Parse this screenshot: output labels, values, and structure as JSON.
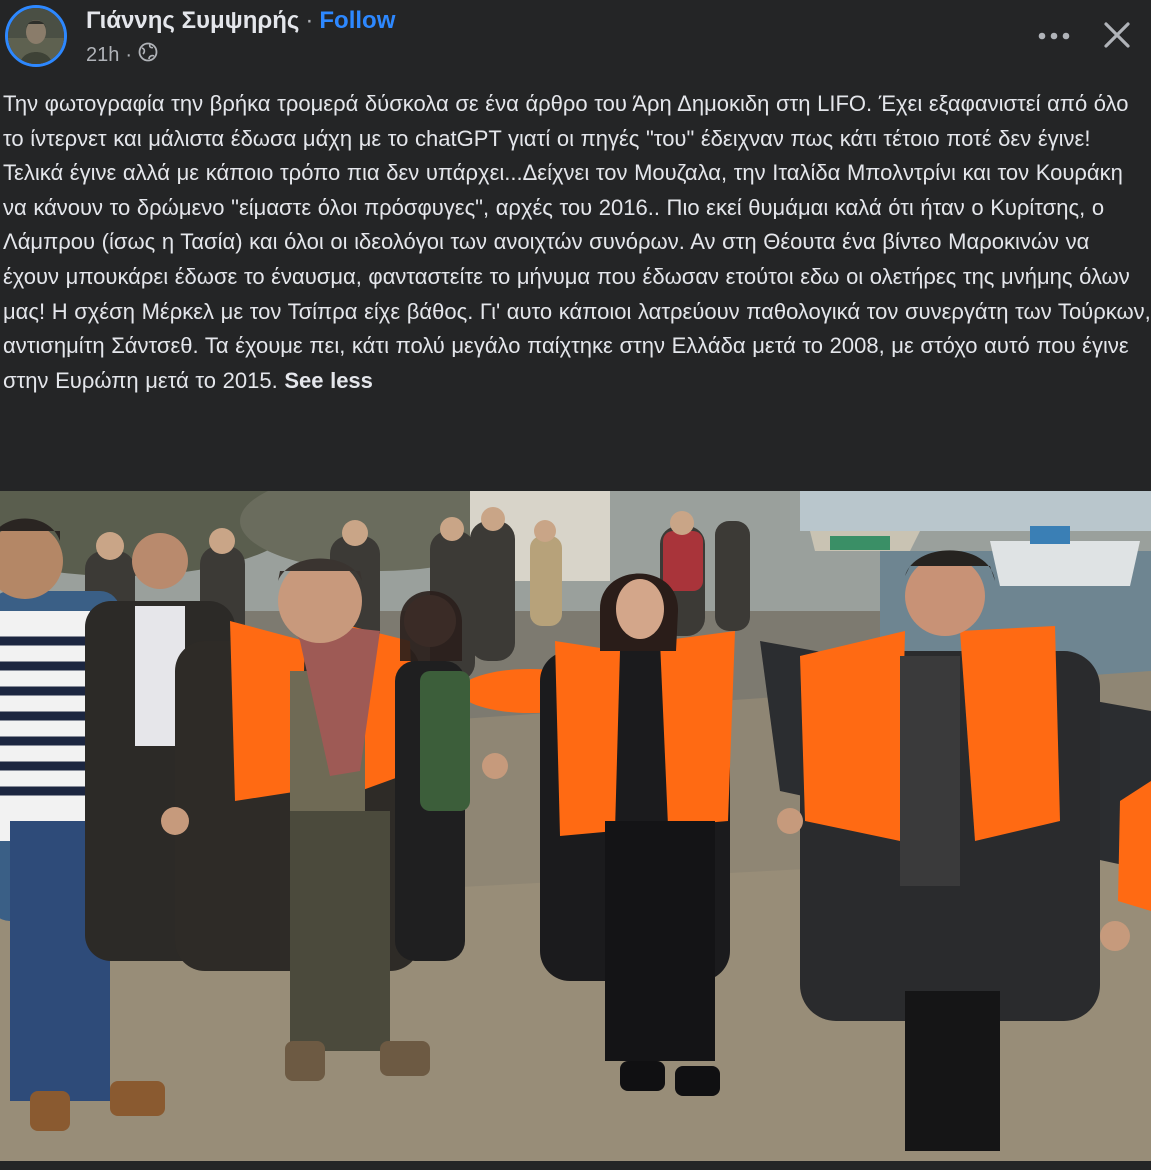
{
  "post": {
    "author_name": "Γιάννης Συμψηρής",
    "separator": "·",
    "follow_label": "Follow",
    "timestamp": "21h",
    "meta_separator": "·",
    "audience_icon": "globe-icon",
    "more_icon": "more-options-icon",
    "close_icon": "close-icon",
    "text": "Την φωτογραφία την βρήκα τρομερά δύσκολα σε ένα άρθρο του Άρη Δημοκιδη στη LIFO. Έχει εξαφανιστεί από όλο το ίντερνετ και μάλιστα έδωσα μάχη με το chatGPT γιατί οι πηγές \"του\" έδειχναν πως κάτι τέτοιο ποτέ δεν έγινε! Τελικά έγινε αλλά με κάποιο τρόπο πια δεν υπάρχει...Δείχνει τον Μουζαλα, την Ιταλίδα Μπολντρίνι και τον Κουράκη να κάνουν το δρώμενο \"είμαστε όλοι πρόσφυγες\", αρχές του 2016.. Πιο εκεί θυμάμαι καλά ότι ήταν ο Κυρίτσης, ο Λάμπρου (ίσως η Τασία) και όλοι οι ιδεολόγοι των ανοιχτών συνόρων. Αν στη Θέουτα ένα βίντεο Μαροκινών να έχουν μπουκάρει έδωσε το έναυσμα, φανταστείτε το μήνυμα που έδωσαν ετούτοι εδω οι ολετήρες της μνήμης όλων μας! Η σχέση Μέρκελ με τον Τσίπρα είχε βάθος. Γι' αυτο κάποιοι λατρεύουν παθολογικά τον συνεργάτη των Τούρκων, αντισημίτη Σάντσεθ. Τα έχουμε πει, κάτι πολύ μεγάλο παίχτηκε στην Ελλάδα μετά το 2008, με στόχο αυτό που έγινε στην Ευρώπη μετά το 2015.",
    "see_less_label": "See less",
    "photo_icon": "post-photo"
  },
  "colors": {
    "background": "#242526",
    "text_primary": "#e4e6eb",
    "text_secondary": "#b0b3b8",
    "accent": "#2d88ff",
    "life_vest": "#ff6a13"
  }
}
